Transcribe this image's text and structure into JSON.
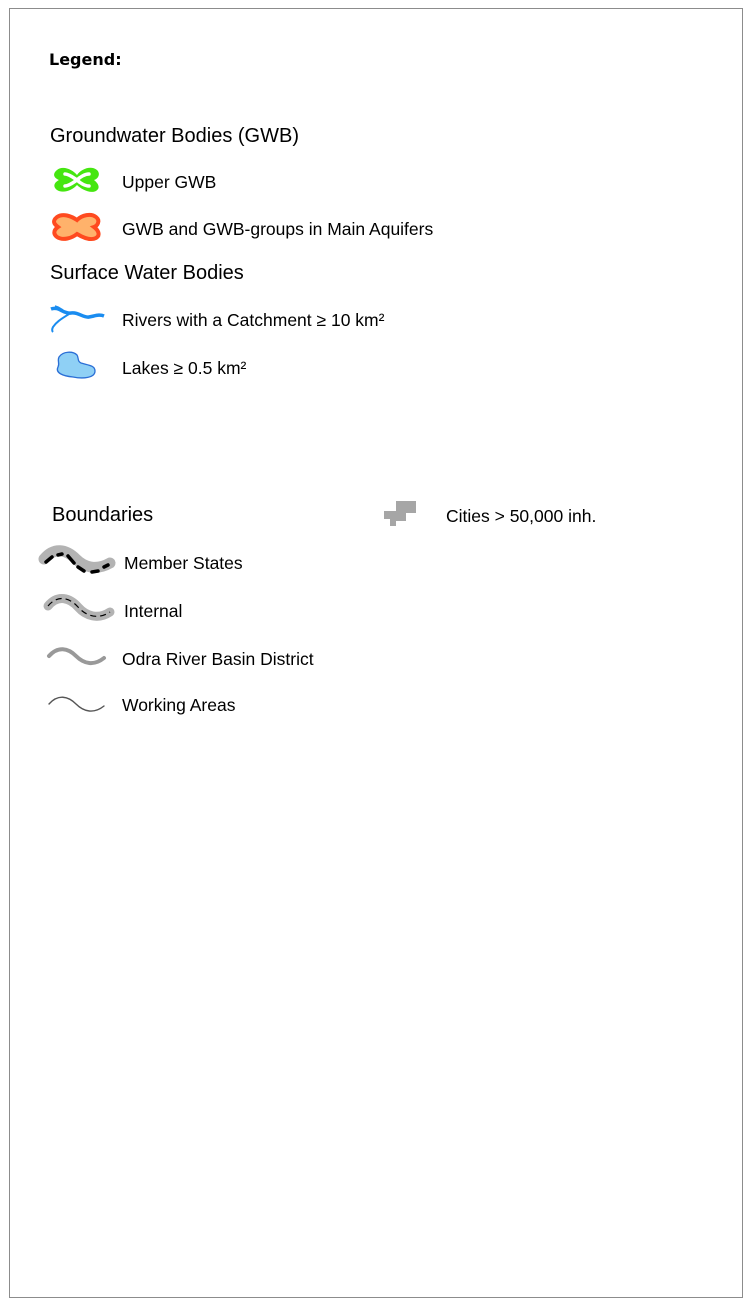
{
  "legend": {
    "title": "Legend:",
    "groundwater": {
      "heading": "Groundwater Bodies (GWB)",
      "items": [
        {
          "label": "Upper GWB",
          "icon": "green-gwb-shape-icon",
          "color": "#45e610"
        },
        {
          "label": "GWB and GWB-groups in Main Aquifers",
          "icon": "orange-gwb-shape-icon",
          "color": "#ff4a1f"
        }
      ]
    },
    "surface_water": {
      "heading": "Surface Water Bodies",
      "items": [
        {
          "label": "Rivers with a Catchment  ≥ 10 km²",
          "icon": "river-line-icon",
          "color": "#1a8cf0"
        },
        {
          "label": "Lakes ≥ 0.5 km²",
          "icon": "lake-shape-icon",
          "color": "#8fd0f5"
        }
      ]
    },
    "boundaries": {
      "heading": "Boundaries",
      "items": [
        {
          "label": "Member States",
          "icon": "member-states-boundary-icon"
        },
        {
          "label": "Internal",
          "icon": "internal-boundary-icon"
        },
        {
          "label": "Odra River Basin District",
          "icon": "river-basin-district-line-icon"
        },
        {
          "label": "Working Areas",
          "icon": "working-areas-line-icon"
        }
      ]
    },
    "cities": {
      "label": "Cities > 50,000 inh.",
      "icon": "city-block-icon",
      "color": "#a6a6a6"
    }
  }
}
